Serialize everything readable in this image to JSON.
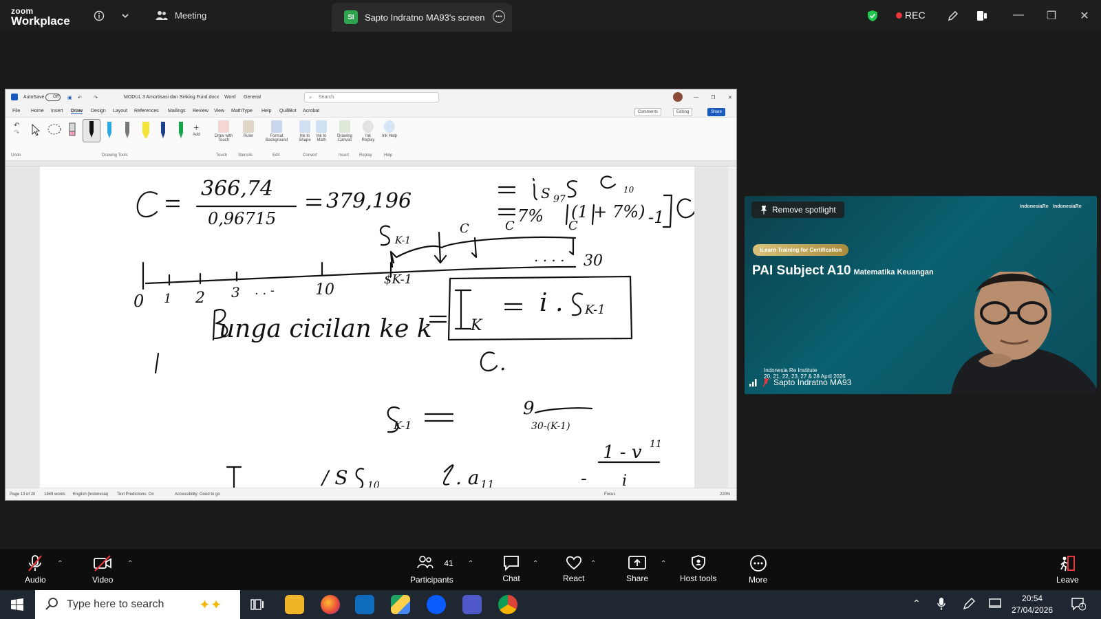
{
  "zoom_header": {
    "logo_line1": "zoom",
    "logo_line2": "Workplace",
    "meeting_label": "Meeting",
    "shared_screen_badge": "SI",
    "shared_screen_label": "Sapto Indratno MA93's screen",
    "rec_label": "REC"
  },
  "word": {
    "autosave_label": "AutoSave",
    "autosave_state": "Off",
    "doc_title": "MODUL 3 Amortisasi dan Sinking Fund.docx",
    "app_name": "Word",
    "sensitivity": "General",
    "search_placeholder": "Search",
    "menu": [
      "File",
      "Home",
      "Insert",
      "Draw",
      "Design",
      "Layout",
      "References",
      "Mailings",
      "Review",
      "View",
      "MathType",
      "Help",
      "QuillBot",
      "Acrobat"
    ],
    "active_menu": "Draw",
    "comments_label": "Comments",
    "editing_label": "Editing",
    "share_label": "Share",
    "ribbon": {
      "undo_group": "Undo",
      "drawing_tools_group": "Drawing Tools",
      "add_label": "Add",
      "draw_with_touch": "Draw with Touch",
      "touch_group": "Touch",
      "ruler": "Ruler",
      "stencils_group": "Stencils",
      "format_background": "Format Background",
      "edit_group": "Edit",
      "ink_to_shape": "Ink to Shape",
      "ink_to_math": "Ink to Math",
      "convert_group": "Convert",
      "drawing_canvas": "Drawing Canvas",
      "insert_group": "Insert",
      "ink_replay": "Ink Replay",
      "replay_group": "Replay",
      "ink_help": "Ink Help",
      "help_group": "Help"
    },
    "status": {
      "page": "Page 13 of 20",
      "words": "1849 words",
      "language": "English (Indonesia)",
      "text_predictions": "Text Predictions: On",
      "accessibility": "Accessibility: Good to go",
      "focus": "Focus",
      "zoom": "220%"
    }
  },
  "video_tile": {
    "remove_spotlight": "Remove spotlight",
    "pill": "iLearn Training for Certification",
    "title": "PAI Subject A10",
    "subtitle": "Matematika Keuangan",
    "institute": "Indonesia Re Institute",
    "dates": "20, 21, 22, 23, 27 & 28 April 2026",
    "participant_name": "Sapto Indratno MA93",
    "logo_left": "IndonesiaRe",
    "logo_right": "IndonesiaRe"
  },
  "toolbar": {
    "audio": "Audio",
    "video": "Video",
    "participants": "Participants",
    "participants_count": "41",
    "chat": "Chat",
    "react": "React",
    "share": "Share",
    "host_tools": "Host tools",
    "more": "More",
    "leave": "Leave"
  },
  "taskbar": {
    "search_placeholder": "Type here to search",
    "time": "20:54",
    "date": "27/04/2026",
    "notification_count": "3"
  }
}
